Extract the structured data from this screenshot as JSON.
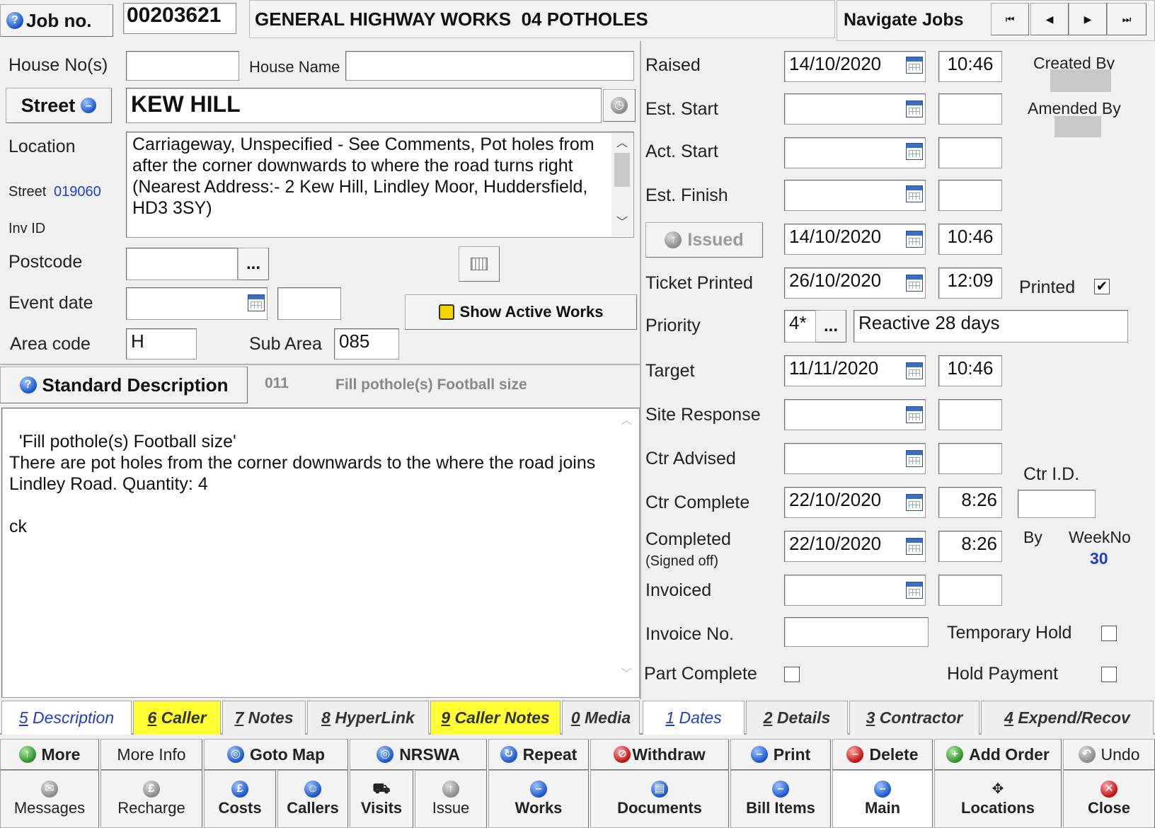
{
  "header": {
    "job_no_label": "Job no.",
    "job_no": "00203621",
    "title": "GENERAL HIGHWAY WORKS  04 POTHOLES",
    "navigate_label": "Navigate Jobs",
    "nav_first": "⏮",
    "nav_prev": "◀",
    "nav_next": "▶",
    "nav_last": "⏭"
  },
  "address": {
    "house_no_label": "House No(s)",
    "house_no": "",
    "house_name_label": "House Name",
    "house_name": "",
    "street_button": "Street",
    "street_name": "KEW HILL",
    "location_label": "Location",
    "location_text": "Carriageway, Unspecified - See Comments, Pot holes from after the corner downwards to where the road turns right (Nearest Address:- 2 Kew Hill, Lindley Moor, Huddersfield, HD3 3SY)",
    "street_code_label": "Street",
    "street_code": "019060",
    "inv_id_label": "Inv ID",
    "postcode_label": "Postcode",
    "postcode": "",
    "ellipsis": "...",
    "event_date_label": "Event date",
    "event_date": "",
    "event_time": "",
    "show_active_works": "Show Active Works",
    "area_code_label": "Area code",
    "area_code": "H",
    "sub_area_label": "Sub Area",
    "sub_area": "085"
  },
  "standard_description": {
    "button": "Standard Description",
    "code": "011",
    "text": "Fill pothole(s) Football size",
    "body": "'Fill pothole(s) Football size'\nThere are pot holes from the corner downwards to the where the road joins Lindley Road. Quantity: 4\n\nck"
  },
  "dates": {
    "raised_label": "Raised",
    "raised_date": "14/10/2020",
    "raised_time": "10:46",
    "created_by_label": "Created By",
    "est_start_label": "Est. Start",
    "amended_by_label": "Amended By",
    "act_start_label": "Act. Start",
    "est_finish_label": "Est. Finish",
    "issued_button": "Issued",
    "issued_date": "14/10/2020",
    "issued_time": "10:46",
    "ticket_printed_label": "Ticket Printed",
    "ticket_printed_date": "26/10/2020",
    "ticket_printed_time": "12:09",
    "printed_label": "Printed",
    "printed_checked": "✔",
    "priority_label": "Priority",
    "priority_code": "4*",
    "priority_text": "Reactive 28 days",
    "target_label": "Target",
    "target_date": "11/11/2020",
    "target_time": "10:46",
    "site_response_label": "Site Response",
    "ctr_advised_label": "Ctr Advised",
    "ctr_id_label": "Ctr I.D.",
    "ctr_id": "",
    "ctr_complete_label": "Ctr Complete",
    "ctr_complete_date": "22/10/2020",
    "ctr_complete_time": "8:26",
    "completed_label": "Completed",
    "signed_off_label": "(Signed off)",
    "completed_date": "22/10/2020",
    "completed_time": "8:26",
    "by_label": "By",
    "weekno_label": "WeekNo",
    "weekno": "30",
    "invoiced_label": "Invoiced",
    "invoice_no_label": "Invoice No.",
    "invoice_no": "",
    "temporary_hold_label": "Temporary Hold",
    "part_complete_label": "Part Complete",
    "hold_payment_label": "Hold Payment"
  },
  "tabs": [
    {
      "key": "5",
      "label": " Description"
    },
    {
      "key": "6",
      "label": " Caller"
    },
    {
      "key": "7",
      "label": " Notes"
    },
    {
      "key": "8",
      "label": " HyperLink"
    },
    {
      "key": "9",
      "label": " Caller Notes"
    },
    {
      "key": "0",
      "label": " Media"
    },
    {
      "key": "1",
      "label": " Dates"
    },
    {
      "key": "2",
      "label": " Details"
    },
    {
      "key": "3",
      "label": " Contractor"
    },
    {
      "key": "4",
      "label": " Expend/Recov"
    }
  ],
  "toolbar1": {
    "more": "More",
    "more_info": "More Info",
    "goto_map": "Goto Map",
    "nrswa": "NRSWA",
    "repeat": "Repeat",
    "withdraw": "Withdraw",
    "print": "Print",
    "delete": "Delete",
    "add_order": "Add Order",
    "undo": "Undo"
  },
  "toolbar2": {
    "messages": "Messages",
    "recharge": "Recharge",
    "costs": "Costs",
    "callers": "Callers",
    "visits": "Visits",
    "issue": "Issue",
    "works": "Works",
    "documents": "Documents",
    "bill_items": "Bill Items",
    "main": "Main",
    "locations": "Locations",
    "close": "Close"
  },
  "colors": {
    "highlight_tab": "#ffff33",
    "link_blue": "#1f3fbf",
    "weekno_blue": "#1a3fd0"
  }
}
